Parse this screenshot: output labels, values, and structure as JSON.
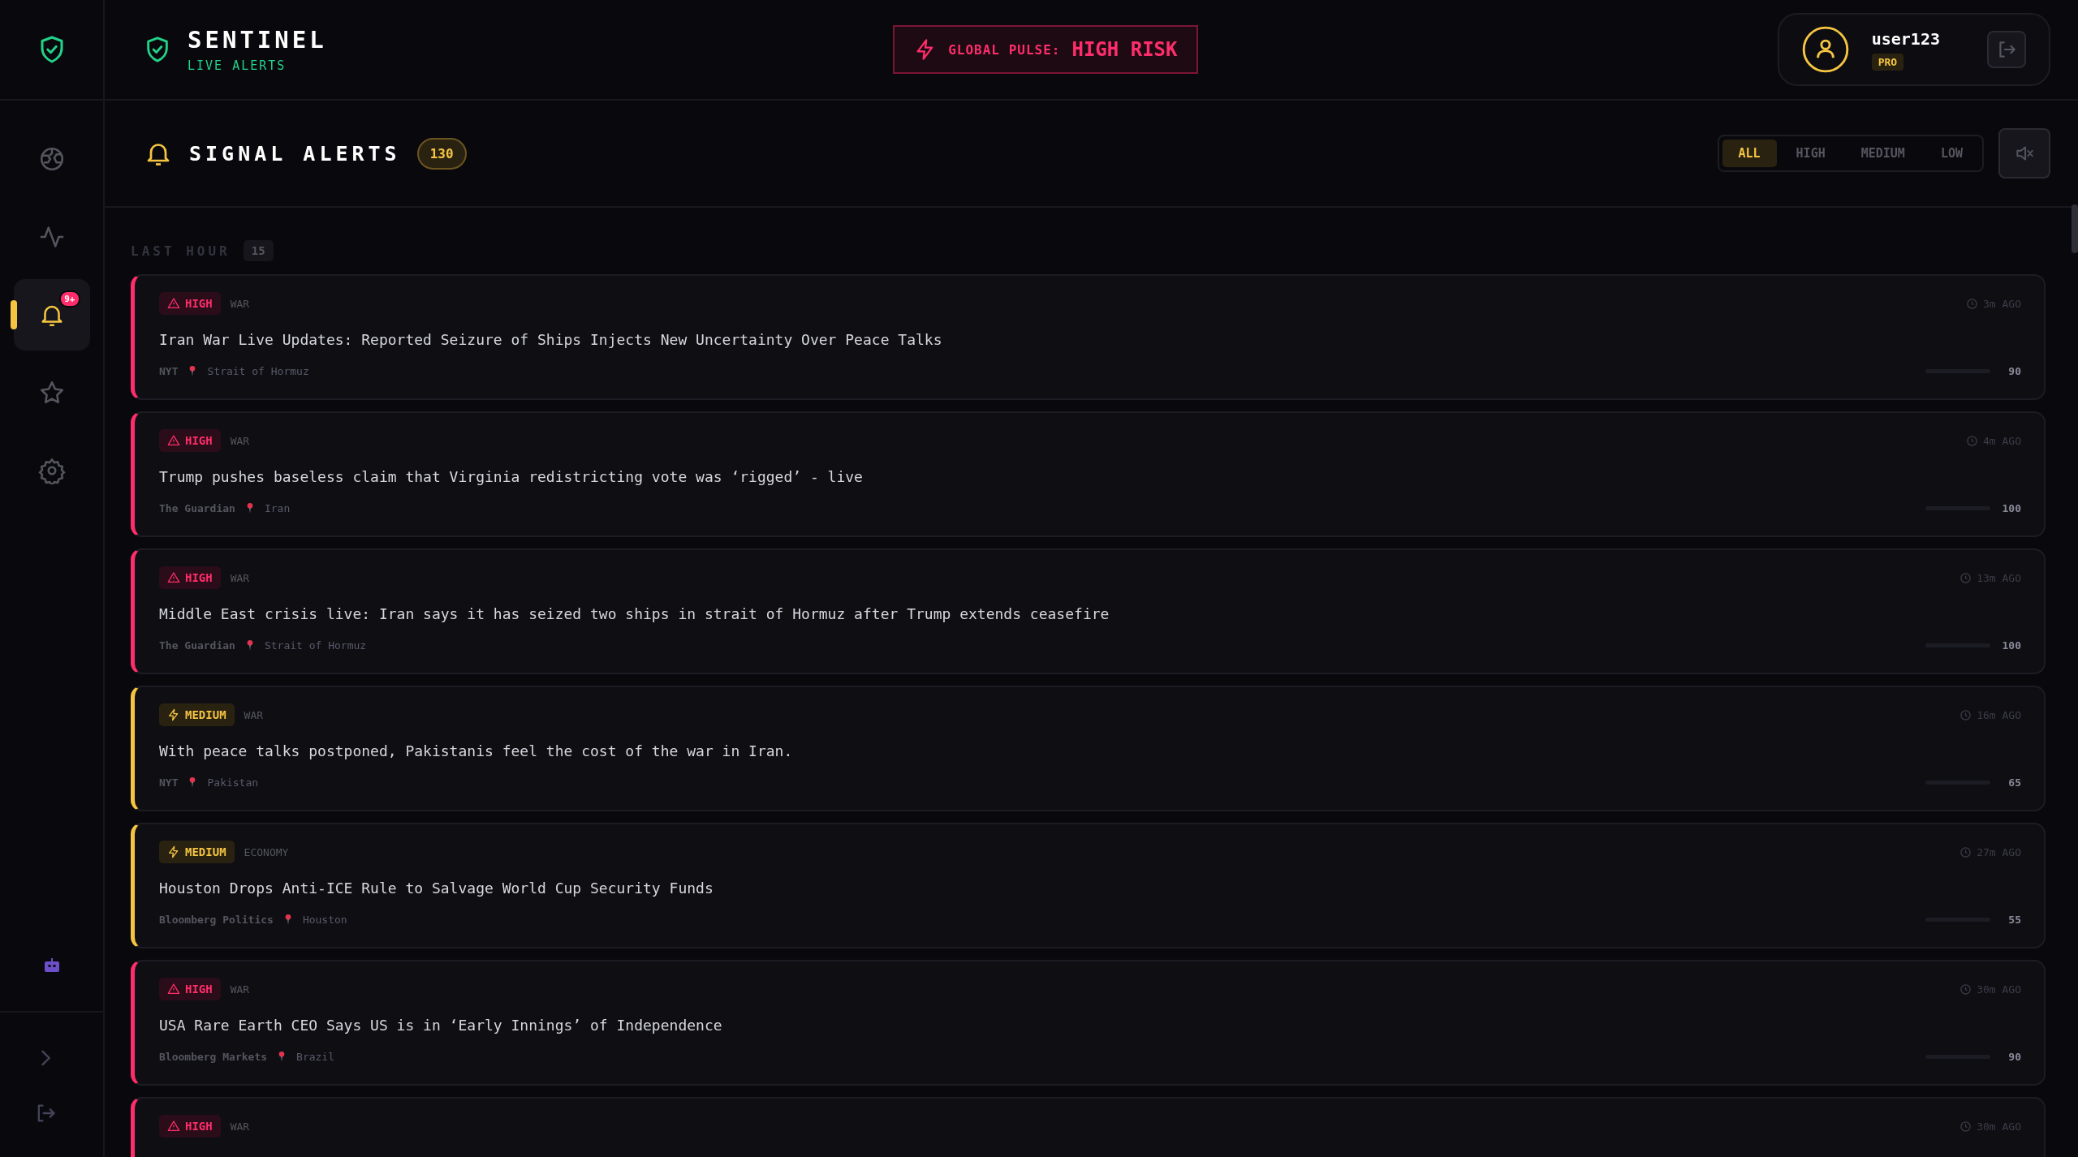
{
  "app": {
    "title": "SENTINEL",
    "subtitle": "LIVE ALERTS"
  },
  "sidebar": {
    "items": [
      {
        "selected": false
      },
      {
        "selected": false
      },
      {
        "selected": true,
        "badge": "9+"
      },
      {
        "selected": false
      },
      {
        "selected": false
      }
    ]
  },
  "global_pulse": {
    "label": "GLOBAL PULSE:",
    "value": "HIGH RISK"
  },
  "user": {
    "name": "user123",
    "plan": "PRO"
  },
  "section": {
    "title": "SIGNAL ALERTS",
    "count": "130"
  },
  "filters": [
    {
      "label": "ALL",
      "selected": true
    },
    {
      "label": "HIGH",
      "selected": false
    },
    {
      "label": "MEDIUM",
      "selected": false
    },
    {
      "label": "LOW",
      "selected": false
    }
  ],
  "group": {
    "label": "LAST HOUR",
    "count": "15"
  },
  "alerts": [
    {
      "kind": "high",
      "label": "HIGH",
      "category": "WAR",
      "time": "3m AGO",
      "title": "Iran War Live Updates: Reported Seizure of Ships Injects New Uncertainty Over Peace Talks",
      "source": "NYT",
      "location": "Strait of Hormuz",
      "score": "90"
    },
    {
      "kind": "high",
      "label": "HIGH",
      "category": "WAR",
      "time": "4m AGO",
      "title": "Trump pushes baseless claim that Virginia redistricting vote was ‘rigged’ - live",
      "source": "The Guardian",
      "location": "Iran",
      "score": "100"
    },
    {
      "kind": "high",
      "label": "HIGH",
      "category": "WAR",
      "time": "13m AGO",
      "title": "Middle East crisis live: Iran says it has seized two ships in strait of Hormuz after Trump extends ceasefire",
      "source": "The Guardian",
      "location": "Strait of Hormuz",
      "score": "100"
    },
    {
      "kind": "medium",
      "label": "MEDIUM",
      "category": "WAR",
      "time": "16m AGO",
      "title": "With peace talks postponed, Pakistanis feel the cost of the war in Iran.",
      "source": "NYT",
      "location": "Pakistan",
      "score": "65"
    },
    {
      "kind": "medium",
      "label": "MEDIUM",
      "category": "ECONOMY",
      "time": "27m AGO",
      "title": "Houston Drops Anti-ICE Rule to Salvage World Cup Security Funds",
      "source": "Bloomberg Politics",
      "location": "Houston",
      "score": "55"
    },
    {
      "kind": "high",
      "label": "HIGH",
      "category": "WAR",
      "time": "30m AGO",
      "title": "USA Rare Earth CEO Says US is in ‘Early Innings’ of Independence",
      "source": "Bloomberg Markets",
      "location": "Brazil",
      "score": "90"
    },
    {
      "kind": "high",
      "label": "HIGH",
      "category": "WAR",
      "time": "30m AGO"
    }
  ]
}
